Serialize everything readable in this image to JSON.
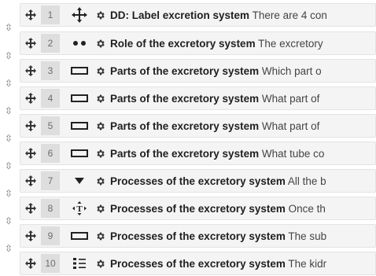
{
  "questions": [
    {
      "number": "1",
      "type_icon": "move-type-icon",
      "title": "DD: Label excretion system",
      "preview": "There are 4 con"
    },
    {
      "number": "2",
      "type_icon": "dots-type-icon",
      "title": "Role of the excretory system",
      "preview": "The excretory"
    },
    {
      "number": "3",
      "type_icon": "short-answer-type-icon",
      "title": "Parts of the excretory system",
      "preview": "Which part o"
    },
    {
      "number": "4",
      "type_icon": "short-answer-type-icon",
      "title": "Parts of the excretory system",
      "preview": "What part of"
    },
    {
      "number": "5",
      "type_icon": "short-answer-type-icon",
      "title": "Parts of the excretory system",
      "preview": "What part of"
    },
    {
      "number": "6",
      "type_icon": "short-answer-type-icon",
      "title": "Parts of the excretory system",
      "preview": "What tube co"
    },
    {
      "number": "7",
      "type_icon": "dropdown-type-icon",
      "title": "Processes of the excretory system",
      "preview": "All the b"
    },
    {
      "number": "8",
      "type_icon": "drag-text-type-icon",
      "title": "Processes of the excretory system",
      "preview": "Once th"
    },
    {
      "number": "9",
      "type_icon": "short-answer-type-icon",
      "title": "Processes of the excretory system",
      "preview": "The sub"
    },
    {
      "number": "10",
      "type_icon": "matching-type-icon",
      "title": "Processes of the excretory system",
      "preview": "The kidr"
    }
  ],
  "icons": {
    "row_handle": "move-handle-icon",
    "page_break": "page-break-icon",
    "edit": "gear-icon"
  }
}
